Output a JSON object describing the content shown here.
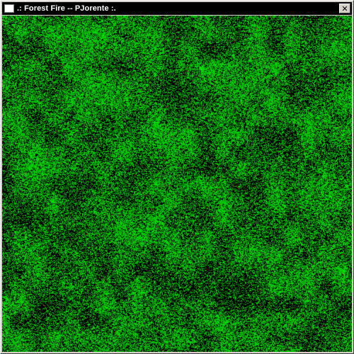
{
  "window": {
    "title": ".: Forest Fire -- PJorente :.",
    "close_glyph": "✕"
  },
  "simulation": {
    "cell_states": [
      "empty",
      "tree",
      "burning"
    ],
    "colors": {
      "empty": "#000000",
      "tree": "#00e000",
      "burning": "#d00000"
    },
    "tree_density": 0.55,
    "burning_density": 0.004
  }
}
